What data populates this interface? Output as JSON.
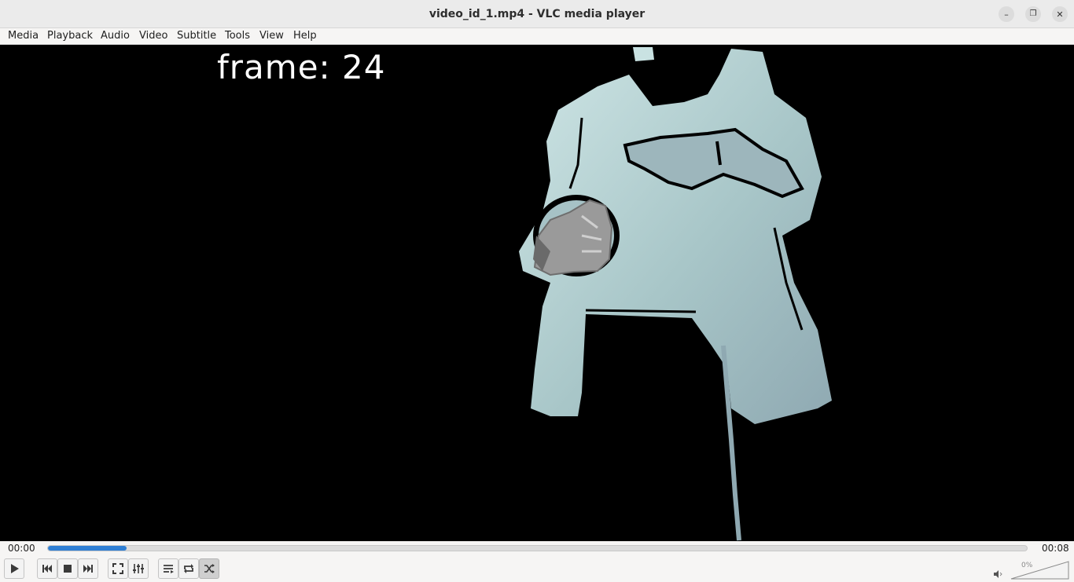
{
  "window": {
    "title": "video_id_1.mp4 - VLC media player",
    "minimize_label": "–",
    "restore_label": "❐",
    "close_label": "✕"
  },
  "menu": {
    "items": [
      {
        "label": "Media"
      },
      {
        "label": "Playback"
      },
      {
        "label": "Audio"
      },
      {
        "label": "Video"
      },
      {
        "label": "Subtitle"
      },
      {
        "label": "Tools"
      },
      {
        "label": "View"
      },
      {
        "label": "Help"
      }
    ]
  },
  "video": {
    "overlay_text": "frame: 24",
    "icon": "depth-person-frame"
  },
  "seek": {
    "elapsed": "00:00",
    "total": "00:08",
    "progress_percent": 8,
    "accent_color": "#2f7fd4"
  },
  "controls": {
    "buttons": [
      {
        "icon": "play-icon"
      },
      {
        "icon": "previous-icon"
      },
      {
        "icon": "stop-icon"
      },
      {
        "icon": "next-icon"
      },
      {
        "icon": "fullscreen-icon"
      },
      {
        "icon": "extended-settings-icon"
      },
      {
        "icon": "playlist-icon"
      },
      {
        "icon": "loop-icon"
      },
      {
        "icon": "shuffle-icon",
        "active": true
      }
    ],
    "volume": {
      "label": "0%",
      "icon": "speaker-muted-icon"
    }
  }
}
